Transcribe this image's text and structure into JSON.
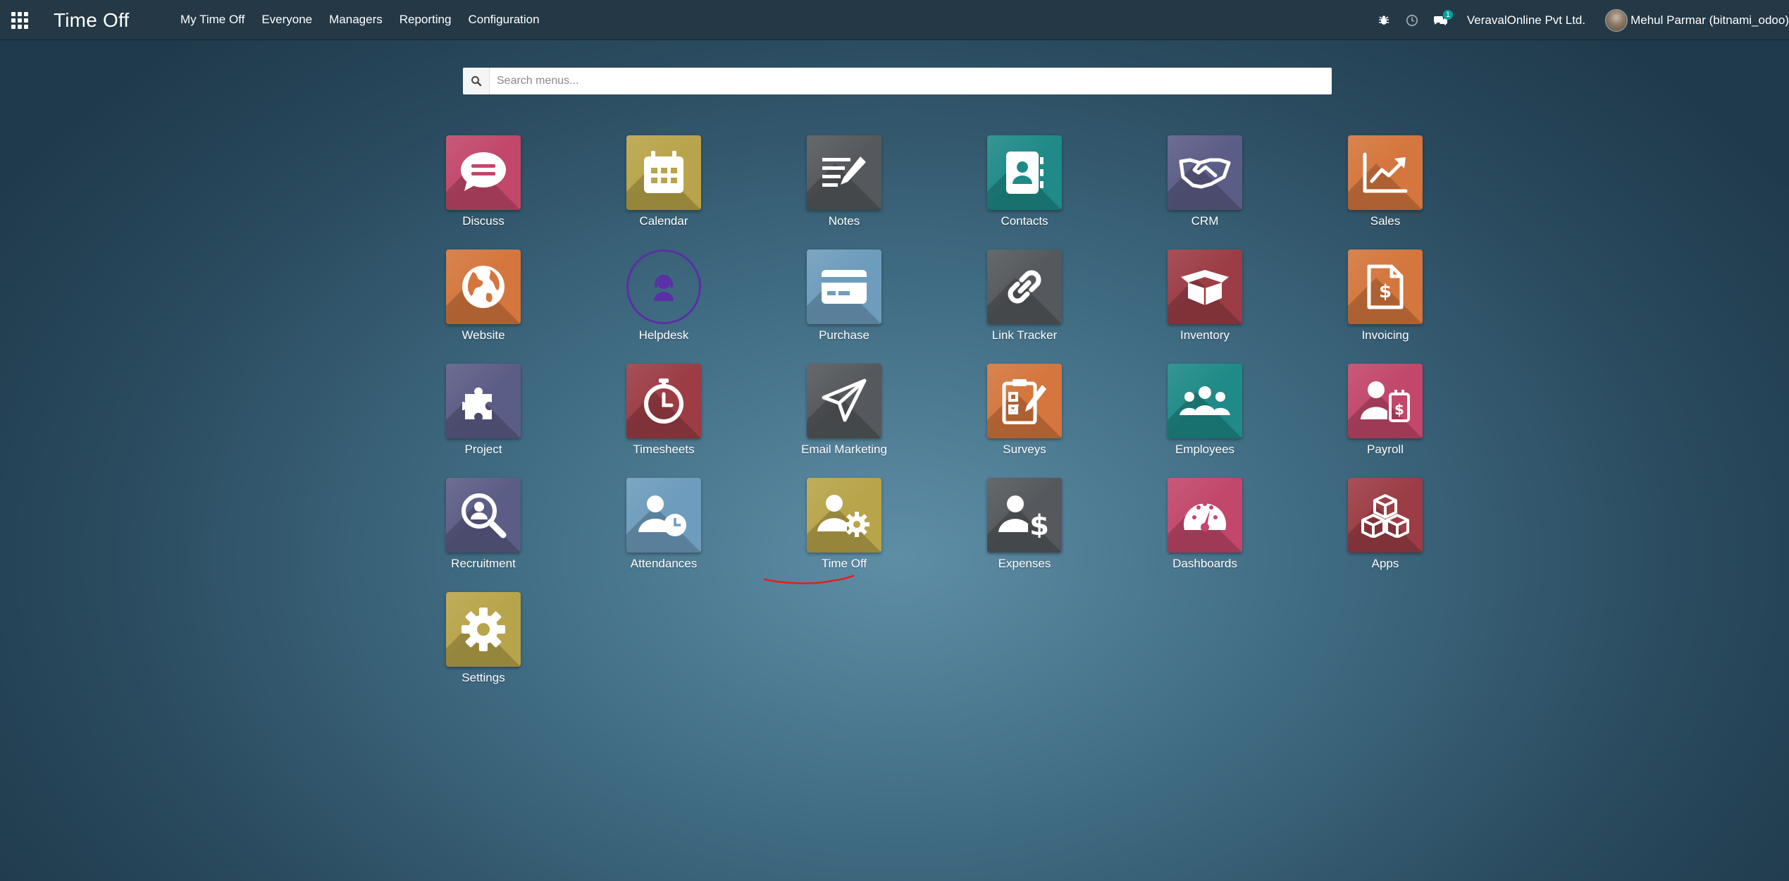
{
  "navbar": {
    "title": "Time Off",
    "menu": [
      "My Time Off",
      "Everyone",
      "Managers",
      "Reporting",
      "Configuration"
    ],
    "chat_badge": "1",
    "company": "VeravalOnline Pvt Ltd.",
    "user_name": "Mehul Parmar (bitnami_odoo)"
  },
  "search": {
    "placeholder": "Search menus..."
  },
  "apps": [
    {
      "label": "Discuss",
      "icon": "chat-bubble-icon",
      "color": "#c2476a"
    },
    {
      "label": "Calendar",
      "icon": "calendar-icon",
      "color": "#b8a44a"
    },
    {
      "label": "Notes",
      "icon": "notes-icon",
      "color": "#55585c"
    },
    {
      "label": "Contacts",
      "icon": "address-book-icon",
      "color": "#1f8a87"
    },
    {
      "label": "CRM",
      "icon": "handshake-icon",
      "color": "#5c5d86"
    },
    {
      "label": "Sales",
      "icon": "trend-chart-icon",
      "color": "#d4763d"
    },
    {
      "label": "Website",
      "icon": "globe-icon",
      "color": "#d4763d"
    },
    {
      "label": "Helpdesk",
      "icon": "headset-user-icon",
      "color": "#5b2fa6"
    },
    {
      "label": "Purchase",
      "icon": "credit-card-icon",
      "color": "#6e9cbc"
    },
    {
      "label": "Link Tracker",
      "icon": "link-icon",
      "color": "#55585c"
    },
    {
      "label": "Inventory",
      "icon": "open-box-icon",
      "color": "#9c3d45"
    },
    {
      "label": "Invoicing",
      "icon": "invoice-dollar-icon",
      "color": "#d4763d"
    },
    {
      "label": "Project",
      "icon": "puzzle-icon",
      "color": "#5c5d86"
    },
    {
      "label": "Timesheets",
      "icon": "stopwatch-icon",
      "color": "#9c3d45"
    },
    {
      "label": "Email Marketing",
      "icon": "paper-plane-icon",
      "color": "#55585c"
    },
    {
      "label": "Surveys",
      "icon": "clipboard-check-icon",
      "color": "#d4763d"
    },
    {
      "label": "Employees",
      "icon": "people-group-icon",
      "color": "#1f8a87"
    },
    {
      "label": "Payroll",
      "icon": "user-dollar-icon",
      "color": "#c2476a"
    },
    {
      "label": "Recruitment",
      "icon": "magnify-user-icon",
      "color": "#5c5d86"
    },
    {
      "label": "Attendances",
      "icon": "user-clock-icon",
      "color": "#6e9cbc"
    },
    {
      "label": "Time Off",
      "icon": "user-gear-icon",
      "color": "#b8a44a"
    },
    {
      "label": "Expenses",
      "icon": "user-dollar-sign-icon",
      "color": "#55585c"
    },
    {
      "label": "Dashboards",
      "icon": "gauge-icon",
      "color": "#c2476a"
    },
    {
      "label": "Apps",
      "icon": "cubes-icon",
      "color": "#9c3d45"
    },
    {
      "label": "Settings",
      "icon": "gear-icon",
      "color": "#b8a44a"
    }
  ],
  "annotation": {
    "color": "#e0201f"
  }
}
